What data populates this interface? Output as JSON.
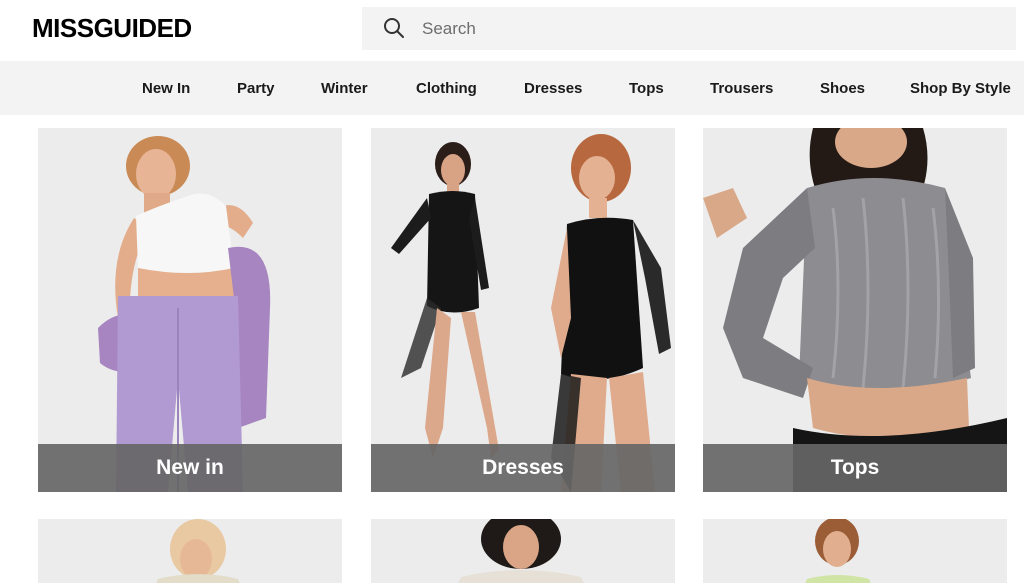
{
  "header": {
    "logo": "MISSGUIDED",
    "search_placeholder": "Search"
  },
  "nav": {
    "items": [
      "New In",
      "Party",
      "Winter",
      "Clothing",
      "Dresses",
      "Tops",
      "Trousers",
      "Shoes",
      "Shop By Style"
    ]
  },
  "categories": [
    {
      "label": "New in"
    },
    {
      "label": "Dresses"
    },
    {
      "label": "Tops"
    }
  ],
  "colors": {
    "nav_bg": "#f3f3f3",
    "label_bar": "#666666",
    "tile_bg": "#ececec"
  }
}
